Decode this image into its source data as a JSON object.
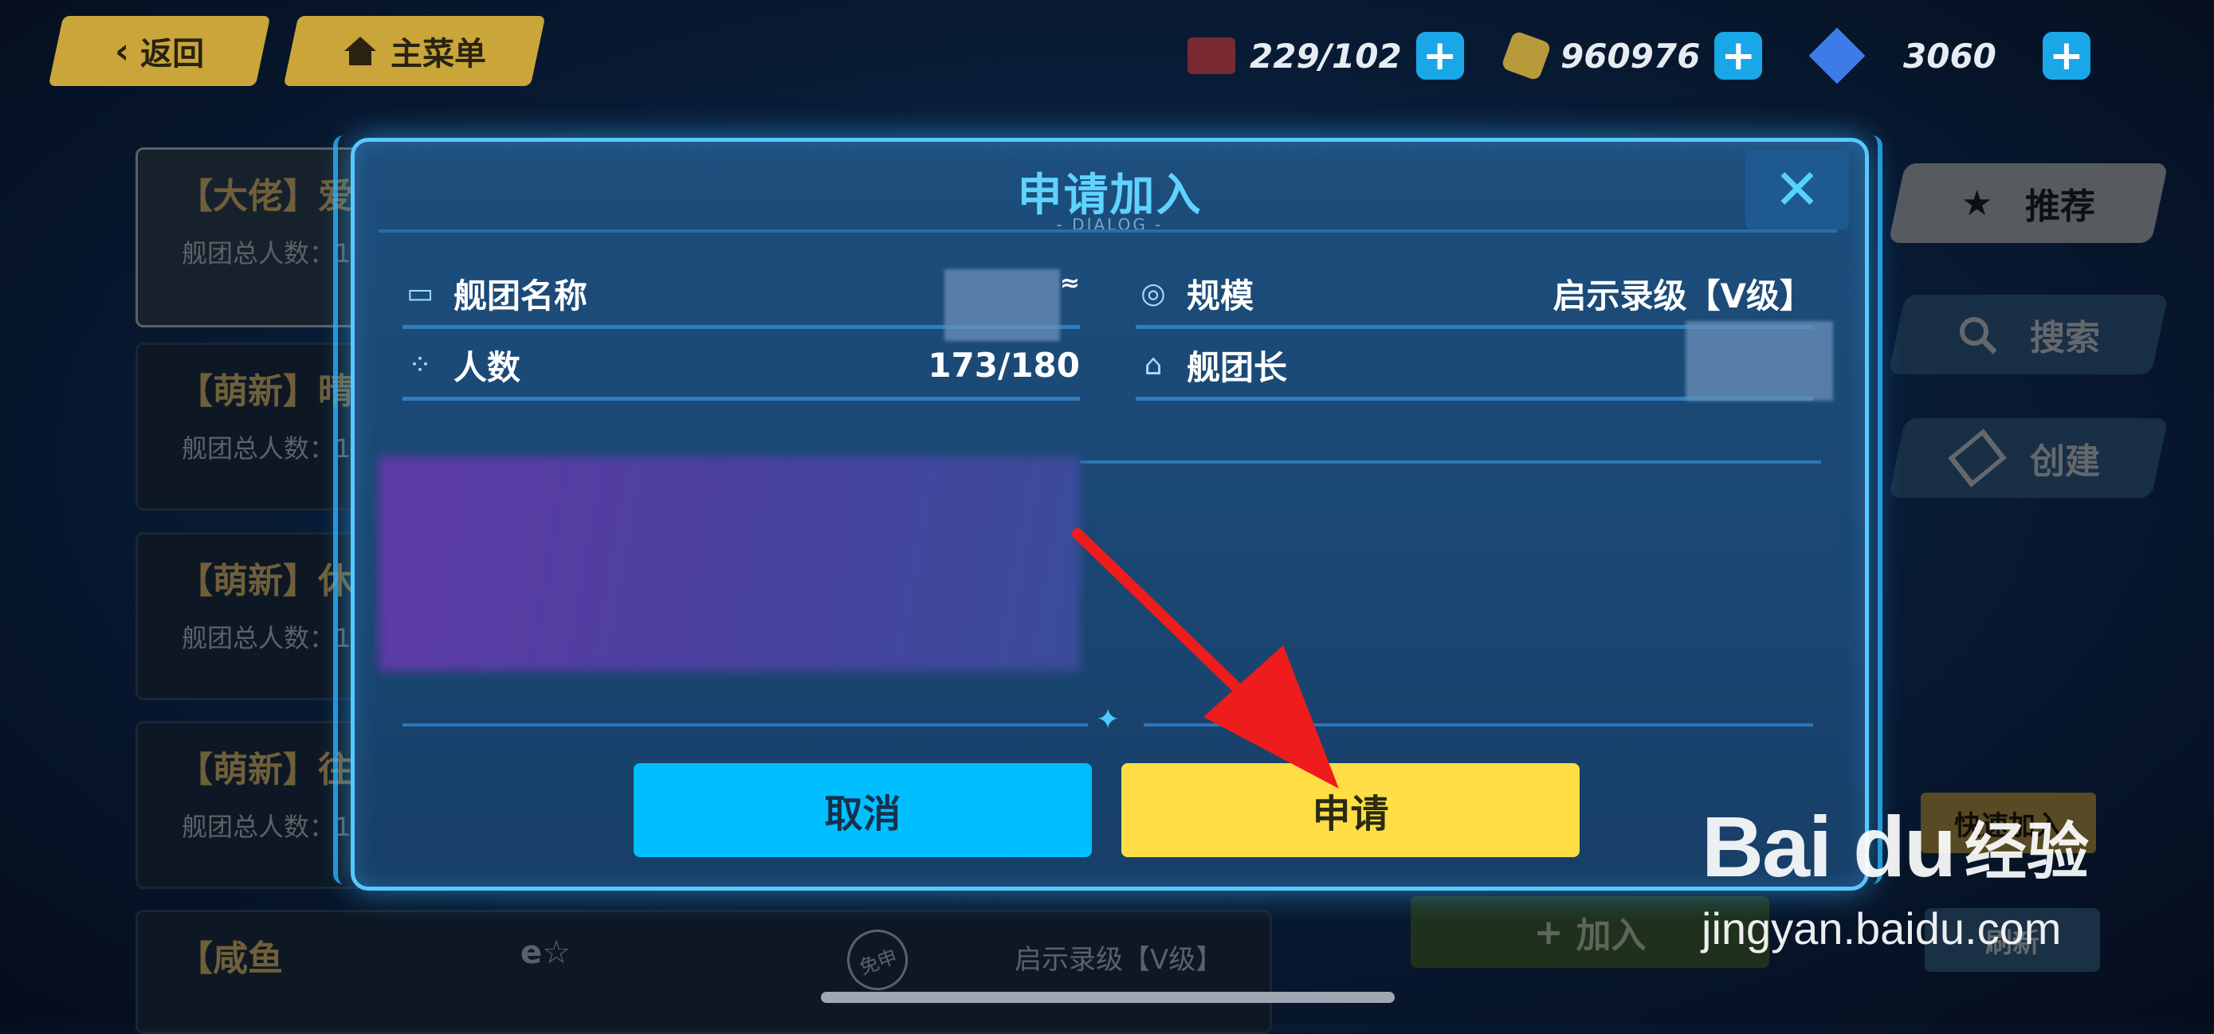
{
  "top": {
    "back_label": "返回",
    "menu_label": "主菜单",
    "resources": [
      {
        "icon": "stamina-icon",
        "value": "229/102"
      },
      {
        "icon": "coin-icon",
        "value": "960976"
      },
      {
        "icon": "crystal-icon",
        "value": "3060"
      }
    ],
    "plus_label": "+"
  },
  "background_list": {
    "cards": [
      {
        "tag": "【大佬】爱",
        "sub": "舰团总人数：1"
      },
      {
        "tag": "【萌新】晴",
        "sub": "舰团总人数：1"
      },
      {
        "tag": "【萌新】休",
        "sub": "舰团总人数：1"
      },
      {
        "tag": "【萌新】往",
        "sub": "舰团总人数：1"
      },
      {
        "tag": "【咸鱼",
        "sub": ""
      }
    ],
    "last_row_suffix": "e☆",
    "last_row_scale": "启示录级【V级】",
    "last_row_badge": "免申"
  },
  "side_tabs": [
    {
      "label": "推荐",
      "icon": "star-icon"
    },
    {
      "label": "搜索",
      "icon": "search-icon"
    },
    {
      "label": "创建",
      "icon": "create-icon"
    }
  ],
  "side_actions": {
    "quick_join": "快速加入",
    "join": "加入",
    "refresh": "刷新"
  },
  "dialog": {
    "title": "申请加入",
    "subtitle": "- DIALOG -",
    "close_label": "✕",
    "fields": {
      "name_label": "舰团名称",
      "name_suffix": "≈",
      "scale_label": "规模",
      "scale_value": "启示录级【V级】",
      "members_label": "人数",
      "members_value": "173/180",
      "leader_label": "舰团长"
    },
    "cancel_label": "取消",
    "apply_label": "申请"
  },
  "watermark": {
    "brand": "Bai du",
    "brand_cn": "经验",
    "url": "jingyan.baidu.com"
  }
}
